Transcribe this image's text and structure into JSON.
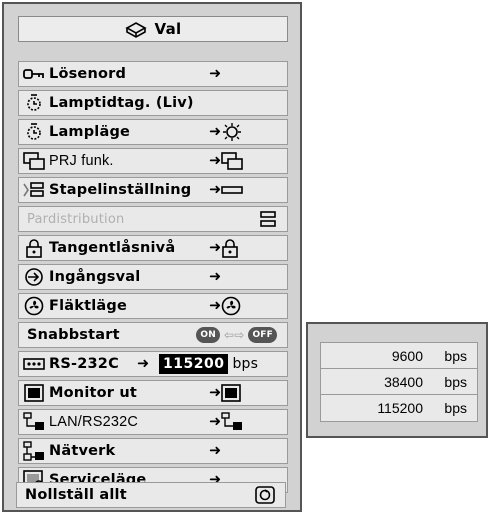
{
  "menu": {
    "title": "Val",
    "items": [
      {
        "label": "Lösenord",
        "icon": "password-key-icon",
        "arrow": "➜"
      },
      {
        "label": "Lamptidtag. (Liv)",
        "icon": "lamp-timer-icon"
      },
      {
        "label": "Lampläge",
        "icon": "lamp-icon",
        "arrow": "➜"
      },
      {
        "label": "PRJ funk.",
        "icon": "prj-function-icon",
        "arrow": "➜"
      },
      {
        "label": "Stapelinställning",
        "icon": "stack-setting-icon",
        "arrow": "➜"
      },
      {
        "label": "Pardistribution",
        "icon": "pair-distribution-icon"
      },
      {
        "label": "Tangentlåsnivå",
        "icon": "lock-icon",
        "arrow": "➜"
      },
      {
        "label": "Ingångsval",
        "icon": "input-select-icon",
        "arrow": "➜"
      },
      {
        "label": "Fläktläge",
        "icon": "fan-icon",
        "arrow": "➜"
      },
      {
        "label": "Snabbstart",
        "icon": "",
        "on_label": "ON",
        "off_label": "OFF"
      },
      {
        "label": "RS-232C",
        "icon": "rs232c-icon",
        "arrow": "➜",
        "value": "115200",
        "unit": "bps"
      },
      {
        "label": "Monitor ut",
        "icon": "monitor-out-icon",
        "arrow": "➜"
      },
      {
        "label": "LAN/RS232C",
        "icon": "lan-rs232c-icon",
        "arrow": "➜"
      },
      {
        "label": "Nätverk",
        "icon": "network-icon",
        "arrow": "➜"
      },
      {
        "label": "Serviceläge",
        "icon": "service-mode-icon",
        "arrow": "➜"
      },
      {
        "label": "Nollställ allt",
        "icon": "",
        "arrow": ""
      }
    ]
  },
  "baud_options": [
    {
      "value": "9600",
      "unit": "bps"
    },
    {
      "value": "38400",
      "unit": "bps"
    },
    {
      "value": "115200",
      "unit": "bps"
    }
  ]
}
